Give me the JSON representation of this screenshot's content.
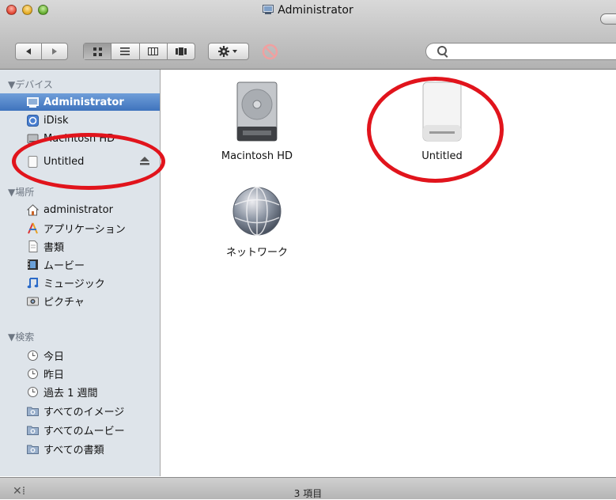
{
  "window": {
    "title": "Administrator"
  },
  "toolbar": {
    "back_icon": "back-arrow-icon",
    "forward_icon": "forward-arrow-icon",
    "views": [
      "icon-view",
      "list-view",
      "column-view",
      "coverflow-view"
    ],
    "selected_view": "icon-view",
    "action_icon": "gear-icon",
    "search_placeholder": ""
  },
  "sidebar": {
    "devices": {
      "heading": "▼デバイス",
      "items": [
        {
          "label": "Administrator",
          "icon": "computer-icon",
          "selected": true
        },
        {
          "label": "iDisk",
          "icon": "idisk-icon"
        },
        {
          "label": "Macintosh HD",
          "icon": "hard-drive-icon"
        },
        {
          "label": "Untitled",
          "icon": "external-drive-icon",
          "eject": true
        }
      ]
    },
    "places": {
      "heading": "▼場所",
      "items": [
        {
          "label": "administrator",
          "icon": "home-icon"
        },
        {
          "label": "アプリケーション",
          "icon": "applications-icon"
        },
        {
          "label": "書類",
          "icon": "documents-icon"
        },
        {
          "label": "ムービー",
          "icon": "movies-icon"
        },
        {
          "label": "ミュージック",
          "icon": "music-icon"
        },
        {
          "label": "ピクチャ",
          "icon": "pictures-icon"
        }
      ]
    },
    "search": {
      "heading": "▼検索",
      "items": [
        {
          "label": "今日",
          "icon": "clock-icon"
        },
        {
          "label": "昨日",
          "icon": "clock-icon"
        },
        {
          "label": "過去 1 週間",
          "icon": "clock-icon"
        },
        {
          "label": "すべてのイメージ",
          "icon": "smart-folder-icon"
        },
        {
          "label": "すべてのムービー",
          "icon": "smart-folder-icon"
        },
        {
          "label": "すべての書類",
          "icon": "smart-folder-icon"
        }
      ]
    }
  },
  "content": {
    "items": [
      {
        "label": "Macintosh HD",
        "icon": "hard-drive-icon"
      },
      {
        "label": "Untitled",
        "icon": "external-drive-icon"
      },
      {
        "label": "ネットワーク",
        "icon": "network-globe-icon"
      }
    ]
  },
  "status": {
    "text": "3 項目"
  },
  "colors": {
    "highlight_ring": "#e1141c",
    "selection": "#3f73bd",
    "sidebar_bg": "#dee4ea"
  }
}
